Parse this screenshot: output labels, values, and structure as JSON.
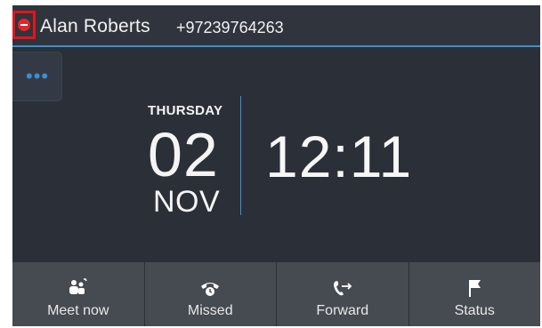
{
  "header": {
    "presence_status_icon": "do-not-disturb-icon",
    "user_name": "Alan Roberts",
    "phone_number": "+97239764263"
  },
  "more_button": {
    "label": "•••"
  },
  "clock": {
    "day_name": "THURSDAY",
    "day_number": "02",
    "month": "NOV",
    "time": "12:11"
  },
  "softkeys": [
    {
      "label": "Meet now",
      "icon": "meet-now-icon"
    },
    {
      "label": "Missed",
      "icon": "missed-calls-icon"
    },
    {
      "label": "Forward",
      "icon": "forward-icon"
    },
    {
      "label": "Status",
      "icon": "flag-icon"
    }
  ],
  "colors": {
    "accent": "#3d8fd1",
    "screen_background": "#2b2f38",
    "softkey_background": "#464a51",
    "do_not_disturb": "#e4242c",
    "highlight_frame": "#e4141b"
  }
}
